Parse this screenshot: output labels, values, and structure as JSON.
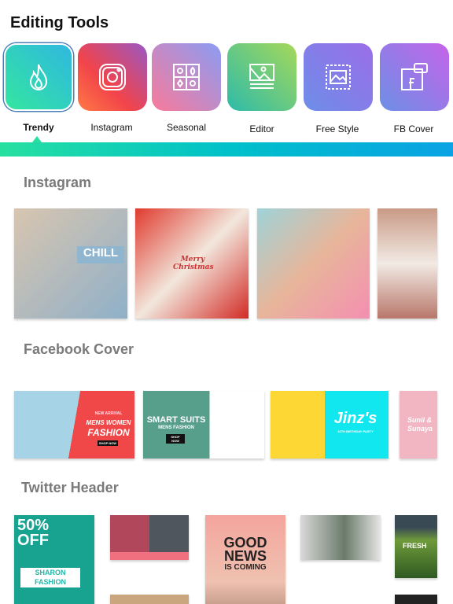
{
  "header": {
    "title": "Editing Tools"
  },
  "tools": [
    {
      "label": "Trendy",
      "icon": "flame-icon",
      "selected": true
    },
    {
      "label": "Instagram",
      "icon": "instagram-icon"
    },
    {
      "label": "Seasonal",
      "icon": "seasons-icon"
    },
    {
      "label": "Editor",
      "icon": "image-editor-icon"
    },
    {
      "label": "Free Style",
      "icon": "free-style-icon"
    },
    {
      "label": "FB Cover",
      "icon": "facebook-cover-icon"
    }
  ],
  "sections": {
    "instagram": {
      "title": "Instagram",
      "cards": [
        {
          "text": "CHILL"
        },
        {
          "text": "Merry Christmas"
        },
        {
          "text": ""
        },
        {
          "text": ""
        }
      ]
    },
    "facebook": {
      "title": "Facebook Cover",
      "cards": [
        {
          "line1": "NEW ARRIVAL",
          "line2": "MENS WOMEN",
          "line3": "FASHION",
          "button": "SHOP NOW"
        },
        {
          "line1": "SMART SUITS",
          "line2": "MENS FASHION",
          "button": "SHOP NOW"
        },
        {
          "line1": "Jinz's",
          "line2": "10TH BIRTHDAY PARTY"
        },
        {
          "line1": "Sunil &",
          "line2": "Sunaya"
        }
      ]
    },
    "twitter": {
      "title": "Twitter Header",
      "cards": [
        {
          "line1": "50%",
          "line2": "OFF",
          "line3": "SHARON",
          "line4": "FASHION"
        },
        {
          "text": ""
        },
        {
          "line1": "GOOD",
          "line2": "NEWS",
          "line3": "IS COMING"
        },
        {
          "text": ""
        },
        {
          "text": "FRESH"
        }
      ]
    }
  }
}
